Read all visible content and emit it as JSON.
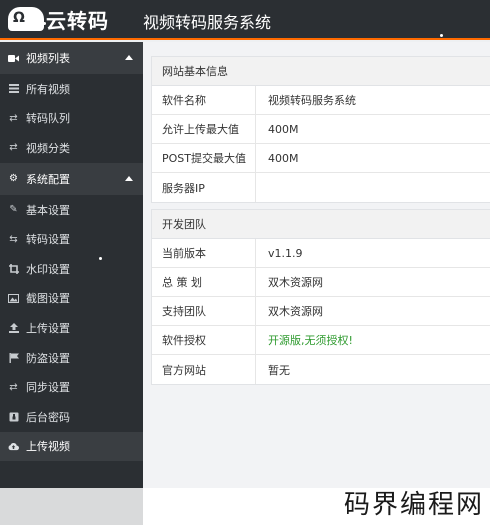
{
  "header": {
    "logo_badge": "Ω",
    "logo_text": "云转码",
    "app_title": "视频转码服务系统"
  },
  "sidebar": {
    "groups": [
      {
        "label": "视频列表",
        "icon": "video-camera-icon",
        "items": [
          {
            "label": "所有视频",
            "icon": "list-icon"
          },
          {
            "label": "转码队列",
            "icon": "exchange-icon"
          },
          {
            "label": "视频分类",
            "icon": "exchange-icon"
          }
        ]
      },
      {
        "label": "系统配置",
        "icon": "gear-icon",
        "items": [
          {
            "label": "基本设置",
            "icon": "edit-icon"
          },
          {
            "label": "转码设置",
            "icon": "retweet-icon"
          },
          {
            "label": "水印设置",
            "icon": "crop-icon"
          },
          {
            "label": "截图设置",
            "icon": "image-icon"
          },
          {
            "label": "上传设置",
            "icon": "upload-icon"
          },
          {
            "label": "防盗设置",
            "icon": "flag-icon"
          },
          {
            "label": "同步设置",
            "icon": "exchange-icon"
          },
          {
            "label": "后台密码",
            "icon": "lock-icon"
          }
        ]
      }
    ],
    "upload": {
      "label": "上传视频",
      "icon": "cloud-upload-icon"
    }
  },
  "site_info": {
    "title": "网站基本信息",
    "rows": [
      {
        "key": "软件名称",
        "value": "视频转码服务系统"
      },
      {
        "key": "允许上传最大值",
        "value": "400M"
      },
      {
        "key": "POST提交最大值",
        "value": "400M"
      },
      {
        "key": "服务器IP",
        "value": ""
      }
    ]
  },
  "dev_team": {
    "title": "开发团队",
    "rows": [
      {
        "key": "当前版本",
        "value": "v1.1.9"
      },
      {
        "key": "总 策 划",
        "value": "双木资源网"
      },
      {
        "key": "支持团队",
        "value": "双木资源网"
      },
      {
        "key": "软件授权",
        "value": "开源版,无须授权!"
      },
      {
        "key": "官方网站",
        "value": "暂无"
      }
    ]
  },
  "colors": {
    "accent": "#ff6a00",
    "sidebar_bg": "#2b2f33",
    "license_text": "#2e9a2e"
  },
  "watermark": "码界编程网"
}
